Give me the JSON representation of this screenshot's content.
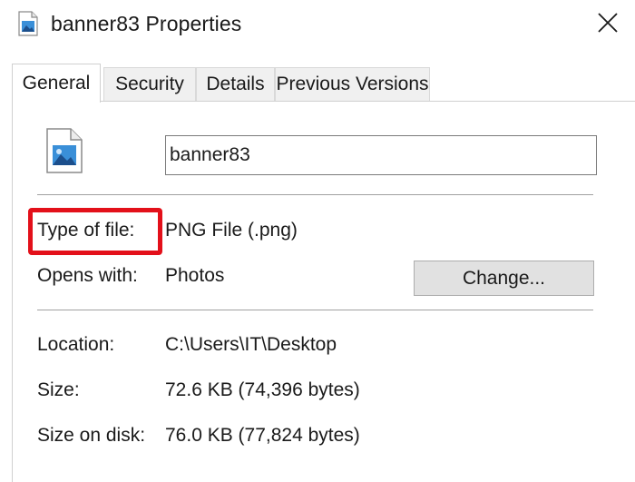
{
  "window": {
    "title": "banner83 Properties",
    "title_icon": "image-file-icon",
    "close_icon": "close-icon"
  },
  "tabs": [
    {
      "label": "General",
      "active": true
    },
    {
      "label": "Security",
      "active": false
    },
    {
      "label": "Details",
      "active": false
    },
    {
      "label": "Previous Versions",
      "active": false
    }
  ],
  "general": {
    "file_icon": "png-image-icon",
    "file_name": "banner83",
    "type_of_file_label": "Type of file:",
    "type_of_file_value": "PNG File (.png)",
    "opens_with_label": "Opens with:",
    "opens_with_value": "Photos",
    "change_button_label": "Change...",
    "location_label": "Location:",
    "location_value": "C:\\Users\\IT\\Desktop",
    "size_label": "Size:",
    "size_value": "72.6 KB (74,396 bytes)",
    "size_on_disk_label": "Size on disk:",
    "size_on_disk_value": "76.0 KB (77,824 bytes)"
  },
  "colors": {
    "highlight": "#e3101a",
    "button_bg": "#e1e1e1",
    "icon_blue": "#2b6cb0"
  }
}
